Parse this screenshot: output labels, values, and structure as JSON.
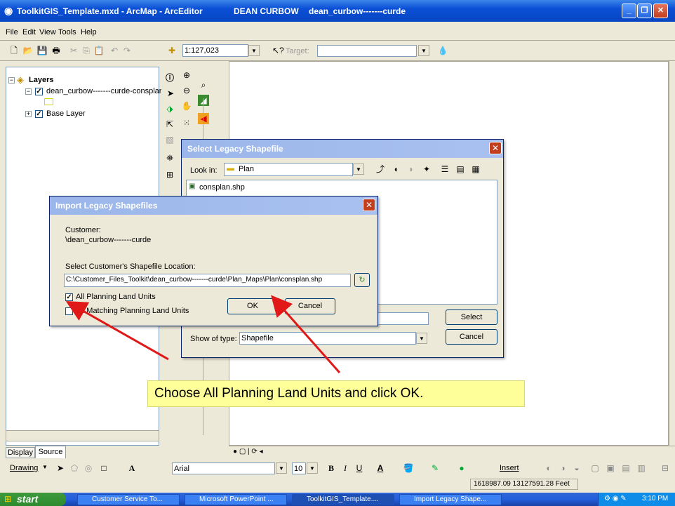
{
  "window": {
    "title": "ToolkitGIS_Template.mxd - ArcMap - ArcEditor",
    "user": "DEAN CURBOW",
    "customer": "dean_curbow-------curde"
  },
  "menu": [
    "File",
    "Edit",
    "View",
    "Tools",
    "Help"
  ],
  "toolbar": {
    "scale": "1:127,023",
    "target_label": "Target:"
  },
  "toc": {
    "root": "Layers",
    "layer1": "dean_curbow-------curde-consplar",
    "layer2": "Base Layer",
    "tab_display": "Display",
    "tab_source": "Source"
  },
  "select_dialog": {
    "title": "Select Legacy Shapefile",
    "look_in_label": "Look in:",
    "look_in": "Plan",
    "file": "consplan.shp",
    "show_type_label": "Show of type:",
    "show_type": "Shapefile",
    "select_button": "Select",
    "cancel_button": "Cancel"
  },
  "import_dialog": {
    "title": "Import Legacy Shapefiles",
    "customer_label": "Customer:",
    "customer": "\\dean_curbow-------curde",
    "location_label": "Select Customer's Shapefile Location:",
    "location": "C:\\Customer_Files_Toolkit\\dean_curbow-------curde\\Plan_Maps\\Plan\\consplan.shp",
    "check_all": "All Planning Land Units",
    "check_all_state": true,
    "check_matching": "All Matching Planning Land Units",
    "check_matching_state": false,
    "ok_button": "OK",
    "cancel_button": "Cancel"
  },
  "callout": "Choose All Planning Land Units and click OK.",
  "drawing": {
    "drawing_label": "Drawing",
    "font": "Arial",
    "size": "10",
    "insert_label": "Insert"
  },
  "status": {
    "coords": "1618987.09  13127591.28 Feet"
  },
  "taskbar": {
    "start": "start",
    "tasks": [
      "Customer Service To...",
      "Microsoft PowerPoint ...",
      "ToolkitGIS_Template....",
      "Import Legacy Shape..."
    ],
    "clock": "3:10 PM"
  }
}
